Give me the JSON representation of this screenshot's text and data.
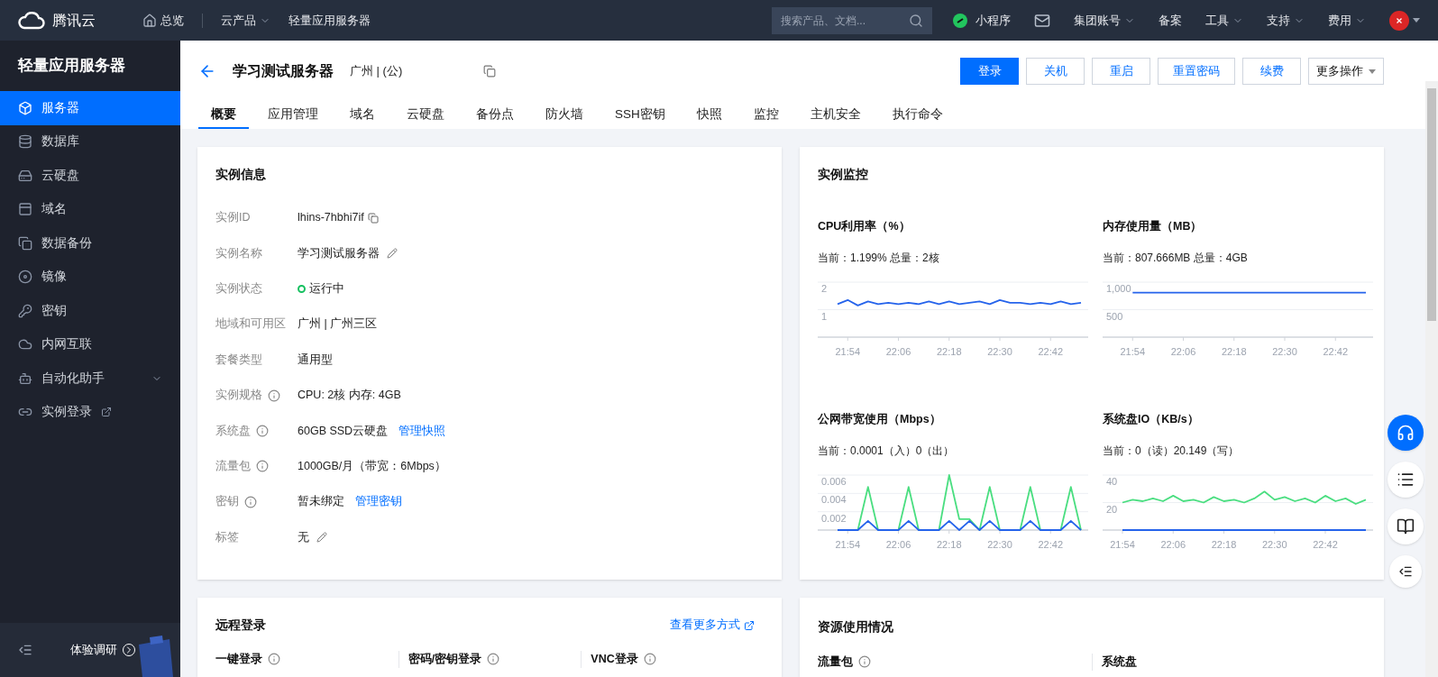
{
  "topbar": {
    "brand": "腾讯云",
    "nav": [
      {
        "label": "总览",
        "kind": "home"
      },
      {
        "label": "云产品",
        "kind": "dropdown"
      },
      {
        "label": "轻量应用服务器",
        "kind": "plain"
      }
    ],
    "search": {
      "placeholder": "搜索产品、文档..."
    },
    "right": [
      {
        "label": "小程序",
        "kind": "miniapp"
      },
      {
        "kind": "mail"
      },
      {
        "label": "集团账号",
        "kind": "dropdown"
      },
      {
        "label": "备案",
        "kind": "plain"
      },
      {
        "label": "工具",
        "kind": "dropdown"
      },
      {
        "label": "支持",
        "kind": "dropdown"
      },
      {
        "label": "费用",
        "kind": "dropdown"
      }
    ]
  },
  "sidebar": {
    "title": "轻量应用服务器",
    "items": [
      {
        "label": "服务器",
        "kind": "server",
        "selected": true
      },
      {
        "label": "数据库",
        "kind": "database",
        "selected": false
      },
      {
        "label": "云硬盘",
        "kind": "disk",
        "selected": false
      },
      {
        "label": "域名",
        "kind": "domain",
        "selected": false
      },
      {
        "label": "数据备份",
        "kind": "backup",
        "selected": false
      },
      {
        "label": "镜像",
        "kind": "image",
        "selected": false
      },
      {
        "label": "密钥",
        "kind": "key",
        "selected": false
      },
      {
        "label": "内网互联",
        "kind": "network",
        "selected": false
      },
      {
        "label": "自动化助手",
        "kind": "group",
        "selected": false
      },
      {
        "label": "实例登录",
        "kind": "external",
        "selected": false
      }
    ],
    "footer": "体验调研"
  },
  "header": {
    "title": "学习测试服务器",
    "region": "广州 | (公)",
    "buttons": [
      {
        "label": "登录",
        "kind": "primary"
      },
      {
        "label": "关机",
        "kind": "default"
      },
      {
        "label": "重启",
        "kind": "default"
      },
      {
        "label": "重置密码",
        "kind": "default"
      },
      {
        "label": "续费",
        "kind": "default"
      },
      {
        "label": "更多操作",
        "kind": "dropdown"
      }
    ],
    "tabs": [
      {
        "label": "概要",
        "selected": true
      },
      {
        "label": "应用管理",
        "selected": false
      },
      {
        "label": "域名",
        "selected": false
      },
      {
        "label": "云硬盘",
        "selected": false
      },
      {
        "label": "备份点",
        "selected": false
      },
      {
        "label": "防火墙",
        "selected": false
      },
      {
        "label": "SSH密钥",
        "selected": false
      },
      {
        "label": "快照",
        "selected": false
      },
      {
        "label": "监控",
        "selected": false
      },
      {
        "label": "主机安全",
        "selected": false
      },
      {
        "label": "执行命令",
        "selected": false
      }
    ]
  },
  "instance_info": {
    "title": "实例信息",
    "rows": [
      {
        "label": "实例ID",
        "info": false,
        "value": "lhins-7hbhi7if",
        "kind": "copyable"
      },
      {
        "label": "实例名称",
        "info": false,
        "value": "学习测试服务器",
        "kind": "editable"
      },
      {
        "label": "实例状态",
        "info": false,
        "value": "运行中",
        "kind": "status"
      },
      {
        "label": "地域和可用区",
        "info": false,
        "value": "广州  |  广州三区",
        "kind": "plain"
      },
      {
        "label": "套餐类型",
        "info": false,
        "value": "通用型",
        "kind": "plain"
      },
      {
        "label": "实例规格",
        "info": true,
        "value": "CPU: 2核 内存: 4GB",
        "kind": "plain"
      },
      {
        "label": "系统盘",
        "info": true,
        "value": "60GB SSD云硬盘",
        "link": "管理快照",
        "kind": "plain"
      },
      {
        "label": "流量包",
        "info": true,
        "value": "1000GB/月（带宽：6Mbps）",
        "kind": "plain"
      },
      {
        "label": "密钥",
        "info": true,
        "value": "暂未绑定",
        "link": "管理密钥",
        "kind": "plain"
      },
      {
        "label": "标签",
        "info": false,
        "value": "无",
        "kind": "editable"
      }
    ]
  },
  "monitor": {
    "title": "实例监控",
    "charts": [
      {
        "title": "CPU利用率（%）",
        "current": "当前：1.199% 总量：2核",
        "chart_data": {
          "type": "line",
          "categories": [
            null,
            "21:54",
            null,
            null,
            null,
            null,
            "22:06",
            null,
            null,
            null,
            null,
            "22:18",
            null,
            null,
            null,
            null,
            "22:30",
            null,
            null,
            null,
            null,
            "22:42",
            null,
            null,
            null
          ],
          "ylim": [
            0,
            2
          ],
          "yticks": [
            1,
            2
          ],
          "grid": true,
          "series": [
            {
              "color": "#2563eb",
              "values": [
                1.2,
                1.35,
                1.15,
                1.3,
                1.2,
                1.25,
                1.2,
                1.25,
                1.2,
                1.3,
                1.2,
                1.3,
                1.2,
                1.25,
                1.3,
                1.2,
                1.35,
                1.25,
                1.25,
                1.2,
                1.25,
                1.2,
                1.3,
                1.2,
                1.25
              ]
            }
          ]
        }
      },
      {
        "title": "内存使用量（MB）",
        "current": "当前：807.666MB 总量：4GB",
        "chart_data": {
          "type": "line",
          "categories": [
            null,
            "21:54",
            null,
            null,
            null,
            null,
            "22:06",
            null,
            null,
            null,
            null,
            "22:18",
            null,
            null,
            null,
            null,
            "22:30",
            null,
            null,
            null,
            null,
            "22:42",
            null,
            null,
            null
          ],
          "ylim": [
            0,
            1000
          ],
          "yticks": [
            {
              "value": 1000,
              "label": "1,000"
            },
            500
          ],
          "grid": true,
          "series": [
            {
              "color": "#2563eb",
              "values": [
                null,
                810,
                810,
                810,
                810,
                810,
                810,
                810,
                810,
                810,
                810,
                810,
                810,
                810,
                810,
                810,
                810,
                810,
                810,
                810,
                810,
                810,
                810,
                810,
                810
              ]
            }
          ]
        }
      },
      {
        "title": "公网带宽使用（Mbps）",
        "current": "当前：0.0001（入）0（出）",
        "chart_data": {
          "type": "line",
          "categories": [
            null,
            "21:54",
            null,
            null,
            null,
            null,
            "22:06",
            null,
            null,
            null,
            null,
            "22:18",
            null,
            null,
            null,
            null,
            "22:30",
            null,
            null,
            null,
            null,
            "22:42",
            null,
            null,
            null
          ],
          "ylim": [
            0,
            0.006
          ],
          "yticks": [
            0.002,
            0.004,
            0.006
          ],
          "grid": true,
          "series": [
            {
              "color": "#4ade80",
              "values": [
                0,
                0,
                0,
                0.0047,
                0,
                0,
                0,
                0.0047,
                0,
                0,
                0,
                0.006,
                0.0012,
                0.0012,
                0,
                0.0047,
                0,
                0,
                0,
                0.0047,
                0,
                0,
                0,
                0.0047,
                0
              ]
            },
            {
              "color": "#2563eb",
              "values": [
                0,
                0,
                0,
                0.001,
                0,
                0,
                0,
                0.001,
                0,
                0,
                0,
                0.001,
                0,
                0.001,
                0,
                0.001,
                0,
                0,
                0,
                0.001,
                0,
                0,
                0,
                0.001,
                0
              ]
            }
          ]
        }
      },
      {
        "title": "系统盘IO（KB/s）",
        "current": "当前：0（读）20.149（写）",
        "chart_data": {
          "type": "line",
          "categories": [
            "21:54",
            null,
            null,
            null,
            null,
            "22:06",
            null,
            null,
            null,
            null,
            "22:18",
            null,
            null,
            null,
            null,
            "22:30",
            null,
            null,
            null,
            null,
            "22:42",
            null,
            null,
            null,
            null
          ],
          "ylim": [
            0,
            40
          ],
          "yticks": [
            40,
            20
          ],
          "grid": true,
          "series": [
            {
              "color": "#4ade80",
              "values": [
                20,
                22,
                21,
                23,
                21,
                25,
                21,
                22,
                20,
                24,
                21,
                22,
                20,
                23,
                28,
                22,
                24,
                21,
                23,
                20,
                25,
                21,
                23,
                19,
                22
              ]
            },
            {
              "color": "#2563eb",
              "values": [
                0,
                0,
                0,
                0,
                0,
                0,
                0,
                0,
                0,
                0,
                0,
                0,
                0,
                0,
                0,
                0,
                0,
                0,
                0,
                0,
                0,
                0,
                0,
                0,
                0
              ]
            }
          ]
        }
      }
    ]
  },
  "remote_login": {
    "title": "远程登录",
    "link": "查看更多方式",
    "methods": [
      {
        "label": "一键登录",
        "info": true
      },
      {
        "label": "密码/密钥登录",
        "info": true
      },
      {
        "label": "VNC登录",
        "info": true
      }
    ]
  },
  "resources": {
    "title": "资源使用情况",
    "items": [
      {
        "label": "流量包",
        "info": true
      },
      {
        "label": "系统盘",
        "info": false
      }
    ]
  }
}
